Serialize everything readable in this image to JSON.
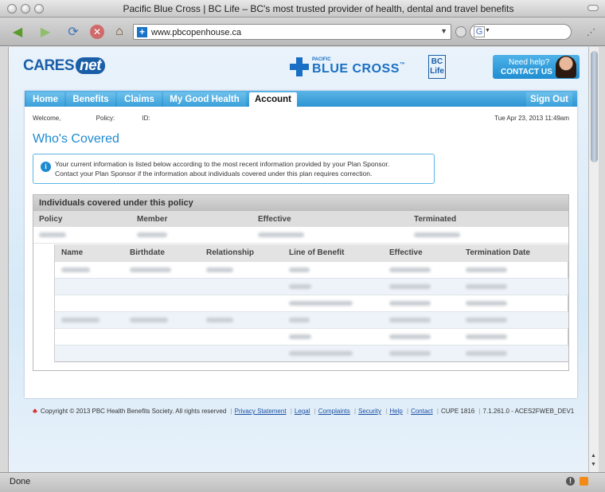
{
  "window": {
    "title": "Pacific Blue Cross | BC Life – BC's most trusted provider of health, dental and travel benefits"
  },
  "browser": {
    "url": "www.pbcopenhouse.ca",
    "search_engine": "G",
    "status": "Done"
  },
  "header": {
    "logo_main": "CARES",
    "logo_net": "net",
    "pbc_small": "PACIFIC",
    "pbc_name": "BLUE CROSS",
    "pbc_tm": "™",
    "bclife_1": "BC",
    "bclife_2": "Life",
    "help_line1": "Need help?",
    "help_line2": "CONTACT US"
  },
  "nav": {
    "tabs": [
      {
        "label": "Home"
      },
      {
        "label": "Benefits"
      },
      {
        "label": "Claims"
      },
      {
        "label": "My Good Health"
      },
      {
        "label": "Account"
      }
    ],
    "active": "Account",
    "signout": "Sign Out"
  },
  "page": {
    "welcome": "Welcome,",
    "policy": "Policy:",
    "id": "ID:",
    "date": "Tue Apr 23, 2013 11:49am",
    "title": "Who's Covered",
    "info_line1": "Your current information is listed below according to the most recent information provided by your Plan Sponsor.",
    "info_line2": "Contact your Plan Sponsor if the information about individuals covered under this plan requires correction.",
    "panel_title": "Individuals covered under this policy",
    "policy_columns": [
      "Policy",
      "Member",
      "Effective",
      "Terminated"
    ],
    "sub_columns": [
      "Name",
      "Birthdate",
      "Relationship",
      "Line of Benefit",
      "Effective",
      "Termination Date"
    ]
  },
  "footer": {
    "copyright": "Copyright © 2013 PBC Health Benefits Society. All rights reserved",
    "links": [
      "Privacy Statement",
      "Legal",
      "Complaints",
      "Security",
      "Help",
      "Contact"
    ],
    "cupe": "CUPE 1816",
    "version": "7.1.261.0 - ACES2FWEB_DEV1"
  },
  "colors": {
    "accent": "#1e8ad1",
    "nav": "#2d95d3",
    "brand": "#1a6fc4"
  }
}
